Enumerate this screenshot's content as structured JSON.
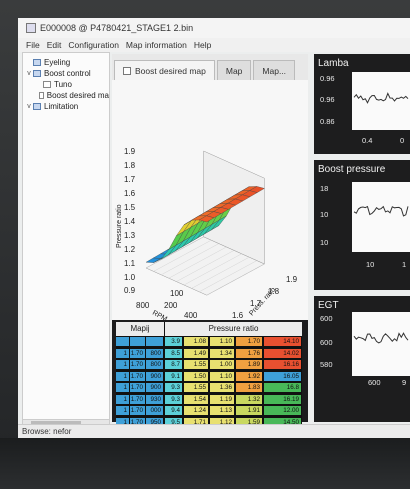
{
  "window": {
    "title": "E000008 @ P4780421_STAGE1  2.bin"
  },
  "menu": [
    "File",
    "Edit",
    "Configuration",
    "Map information",
    "Help"
  ],
  "sidebar": {
    "items": [
      {
        "label": "Eyeling",
        "toggle": "",
        "level": 1
      },
      {
        "label": "Boost control",
        "toggle": "v",
        "level": 1
      },
      {
        "label": "Tuno",
        "toggle": "",
        "level": 2
      },
      {
        "label": "Boost desired ma",
        "toggle": "",
        "level": 2
      },
      {
        "label": "Limitation",
        "toggle": "v",
        "level": 1
      }
    ]
  },
  "tabs": [
    {
      "label": "Boost desired map",
      "active": true
    },
    {
      "label": "Map",
      "active": false
    },
    {
      "label": "Map...",
      "active": false
    }
  ],
  "surface_plot": {
    "z_label": "Pressure ratio",
    "z_ticks": [
      "0.9",
      "1.0",
      "1.1",
      "1.2",
      "1.3",
      "1.4",
      "1.5",
      "1.6",
      "1.7",
      "1.8",
      "1.9"
    ],
    "x_label": "RPM",
    "x_ticks": [
      "800",
      "100",
      "200",
      "400"
    ],
    "y_label": "Press. ratio",
    "y_ticks": [
      "1.6",
      "1.7",
      "1.8",
      "1.9"
    ]
  },
  "table": {
    "headers": [
      "Mapij",
      "Pressure ratio"
    ],
    "rows": [
      [
        "1",
        "1.70",
        "800",
        "8.5",
        "1.49",
        "1.34",
        "1.76",
        "14.02"
      ],
      [
        "1",
        "1.70",
        "800",
        "8.7",
        "1.55",
        "1.00",
        "1.89",
        "16.16"
      ],
      [
        "1",
        "1.70",
        "900",
        "9.1",
        "1.50",
        "1.10",
        "1.92",
        "16.05"
      ],
      [
        "1",
        "1.70",
        "900",
        "9.3",
        "1.55",
        "1.36",
        "1.83",
        "16.8"
      ],
      [
        "1",
        "1.70",
        "930",
        "9.3",
        "1.54",
        "1.19",
        "1.32",
        "16.19"
      ],
      [
        "1",
        "1.70",
        "000",
        "9.4",
        "1.24",
        "1.13",
        "1.91",
        "12.00"
      ],
      [
        "1",
        "1.70",
        "950",
        "9.5",
        "1.71",
        "1.12",
        "1.59",
        "14.50"
      ],
      [
        "1",
        "1.70",
        "1000",
        "9.6",
        "1.30",
        "1.12",
        "1.89",
        "13.18"
      ]
    ],
    "first_row": [
      "",
      "",
      "",
      "3.9",
      "1.08",
      "1.10",
      "1.70",
      "14.10"
    ]
  },
  "panels": [
    {
      "title": "Lamba",
      "yticks": [
        "0.96",
        "0.96",
        "0.86"
      ],
      "xticks": [
        "0.4",
        "0"
      ]
    },
    {
      "title": "Boost pressure",
      "yticks": [
        "18",
        "10",
        "10"
      ],
      "xticks": [
        "10",
        "1"
      ]
    },
    {
      "title": "EGT",
      "yticks": [
        "600",
        "600",
        "580"
      ],
      "xticks": [
        "600",
        "9"
      ]
    }
  ],
  "status": "Browse: nefor",
  "colors": {
    "table_blue": "#3ea0d8",
    "table_cyan": "#5cd0d8",
    "table_green": "#60c060",
    "table_yellow": "#e8e070",
    "table_orange": "#f0a040",
    "table_red": "#e85030"
  }
}
